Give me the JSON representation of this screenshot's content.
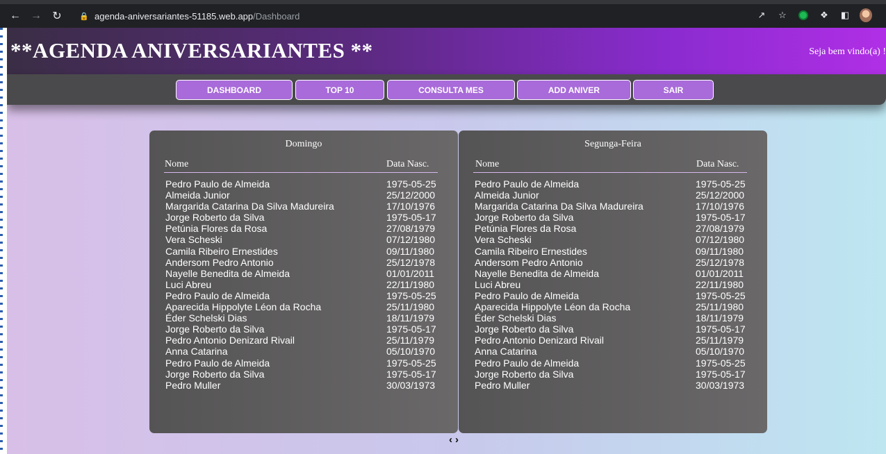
{
  "browser": {
    "url_host": "agenda-aniversariantes-51185.web.app",
    "url_path": "/Dashboard",
    "back_icon": "arrow-left-icon",
    "forward_icon": "arrow-right-icon",
    "reload_icon": "reload-icon"
  },
  "header": {
    "title": "**AGENDA ANIVERSARIANTES **",
    "welcome": "Seja bem vindo(a) !"
  },
  "nav": {
    "items": [
      {
        "label": "DASHBOARD"
      },
      {
        "label": "TOP 10"
      },
      {
        "label": "CONSULTA MES"
      },
      {
        "label": "ADD ANIVER"
      },
      {
        "label": "SAIR"
      }
    ]
  },
  "cards": [
    {
      "title": "Domingo",
      "col_name": "Nome",
      "col_date": "Data Nasc.",
      "rows": [
        [
          "Pedro Paulo de Almeida",
          "1975-05-25"
        ],
        [
          "Almeida Junior",
          "25/12/2000"
        ],
        [
          "Margarida Catarina Da Silva Madureira",
          "17/10/1976"
        ],
        [
          "Jorge Roberto da Silva",
          "1975-05-17"
        ],
        [
          "Petúnia Flores da Rosa",
          "27/08/1979"
        ],
        [
          "Vera Scheski",
          "07/12/1980"
        ],
        [
          "Camila Ribeiro Ernestides",
          "09/11/1980"
        ],
        [
          "Andersom Pedro Antonio",
          "25/12/1978"
        ],
        [
          "Nayelle Benedita de Almeida",
          "01/01/2011"
        ],
        [
          "Luci Abreu",
          "22/11/1980"
        ],
        [
          "Pedro Paulo de Almeida",
          "1975-05-25"
        ],
        [
          "Aparecida Hippolyte Léon da Rocha",
          "25/11/1980"
        ],
        [
          "Éder Schelski Dias",
          "18/11/1979"
        ],
        [
          "Jorge Roberto da Silva",
          "1975-05-17"
        ],
        [
          "Pedro Antonio Denizard Rivail",
          "25/11/1979"
        ],
        [
          "Anna Catarina",
          "05/10/1970"
        ],
        [
          "Pedro Paulo de Almeida",
          "1975-05-25"
        ],
        [
          "Jorge Roberto da Silva",
          "1975-05-17"
        ],
        [
          "Pedro Muller",
          "30/03/1973"
        ]
      ]
    },
    {
      "title": "Segunga-Feira",
      "col_name": "Nome",
      "col_date": "Data Nasc.",
      "rows": [
        [
          "Pedro Paulo de Almeida",
          "1975-05-25"
        ],
        [
          "Almeida Junior",
          "25/12/2000"
        ],
        [
          "Margarida Catarina Da Silva Madureira",
          "17/10/1976"
        ],
        [
          "Jorge Roberto da Silva",
          "1975-05-17"
        ],
        [
          "Petúnia Flores da Rosa",
          "27/08/1979"
        ],
        [
          "Vera Scheski",
          "07/12/1980"
        ],
        [
          "Camila Ribeiro Ernestides",
          "09/11/1980"
        ],
        [
          "Andersom Pedro Antonio",
          "25/12/1978"
        ],
        [
          "Nayelle Benedita de Almeida",
          "01/01/2011"
        ],
        [
          "Luci Abreu",
          "22/11/1980"
        ],
        [
          "Pedro Paulo de Almeida",
          "1975-05-25"
        ],
        [
          "Aparecida Hippolyte Léon da Rocha",
          "25/11/1980"
        ],
        [
          "Éder Schelski Dias",
          "18/11/1979"
        ],
        [
          "Jorge Roberto da Silva",
          "1975-05-17"
        ],
        [
          "Pedro Antonio Denizard Rivail",
          "25/11/1979"
        ],
        [
          "Anna Catarina",
          "05/10/1970"
        ],
        [
          "Pedro Paulo de Almeida",
          "1975-05-25"
        ],
        [
          "Jorge Roberto da Silva",
          "1975-05-17"
        ],
        [
          "Pedro Muller",
          "30/03/1973"
        ]
      ]
    }
  ],
  "pager": {
    "prev": "‹",
    "next": "›"
  }
}
